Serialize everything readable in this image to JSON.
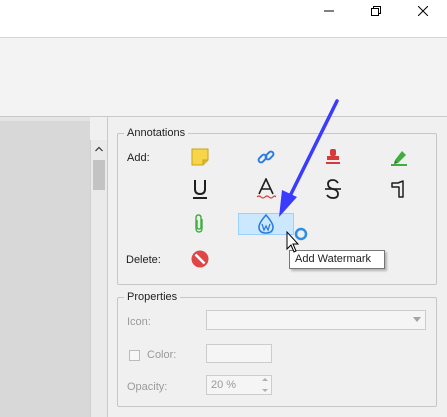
{
  "window": {
    "controls": [
      "minimize-icon",
      "maximize-icon",
      "close-icon"
    ]
  },
  "annotations": {
    "title": "Annotations",
    "add_label": "Add:",
    "delete_label": "Delete:",
    "tools": [
      {
        "name": "sticky-note-icon",
        "color": "#f5d547"
      },
      {
        "name": "link-icon",
        "color": "#2b7de1"
      },
      {
        "name": "stamp-icon",
        "color": "#d63a3a"
      },
      {
        "name": "highlighter-icon",
        "color": "#3fae3f"
      },
      {
        "name": "underline-icon"
      },
      {
        "name": "squiggly-text-icon",
        "color": "#d63a3a"
      },
      {
        "name": "strikethrough-icon"
      },
      {
        "name": "callout-icon"
      },
      {
        "name": "paperclip-icon",
        "color": "#3fae3f"
      },
      {
        "name": "watermark-icon",
        "color": "#2b7de1",
        "highlighted": true
      }
    ],
    "delete_icon": "no-entry-icon",
    "tooltip": "Add Watermark"
  },
  "properties": {
    "title": "Properties",
    "icon_label": "Icon:",
    "color_label": "Color:",
    "opacity_label": "Opacity:",
    "opacity_value": "20 %"
  },
  "cursor": "arrow-cursor-with-busy-icon",
  "arrow_color": "#3b3bff"
}
